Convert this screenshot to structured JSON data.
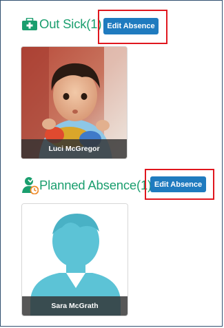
{
  "sections": [
    {
      "title": "Out Sick(1)",
      "icon": "medical-kit-icon",
      "edit_label": "Edit Absence",
      "students": [
        {
          "name": "Luci McGregor",
          "photo": "child-photo"
        }
      ]
    },
    {
      "title": "Planned Absence(1)",
      "icon": "person-clock-icon",
      "edit_label": "Edit Absence",
      "students": [
        {
          "name": "Sara McGrath",
          "photo": "default-avatar"
        }
      ]
    }
  ],
  "colors": {
    "title": "#1a9e6e",
    "button": "#1f7bbf",
    "highlight": "#e0161e",
    "avatar": "#5cc3d6"
  }
}
